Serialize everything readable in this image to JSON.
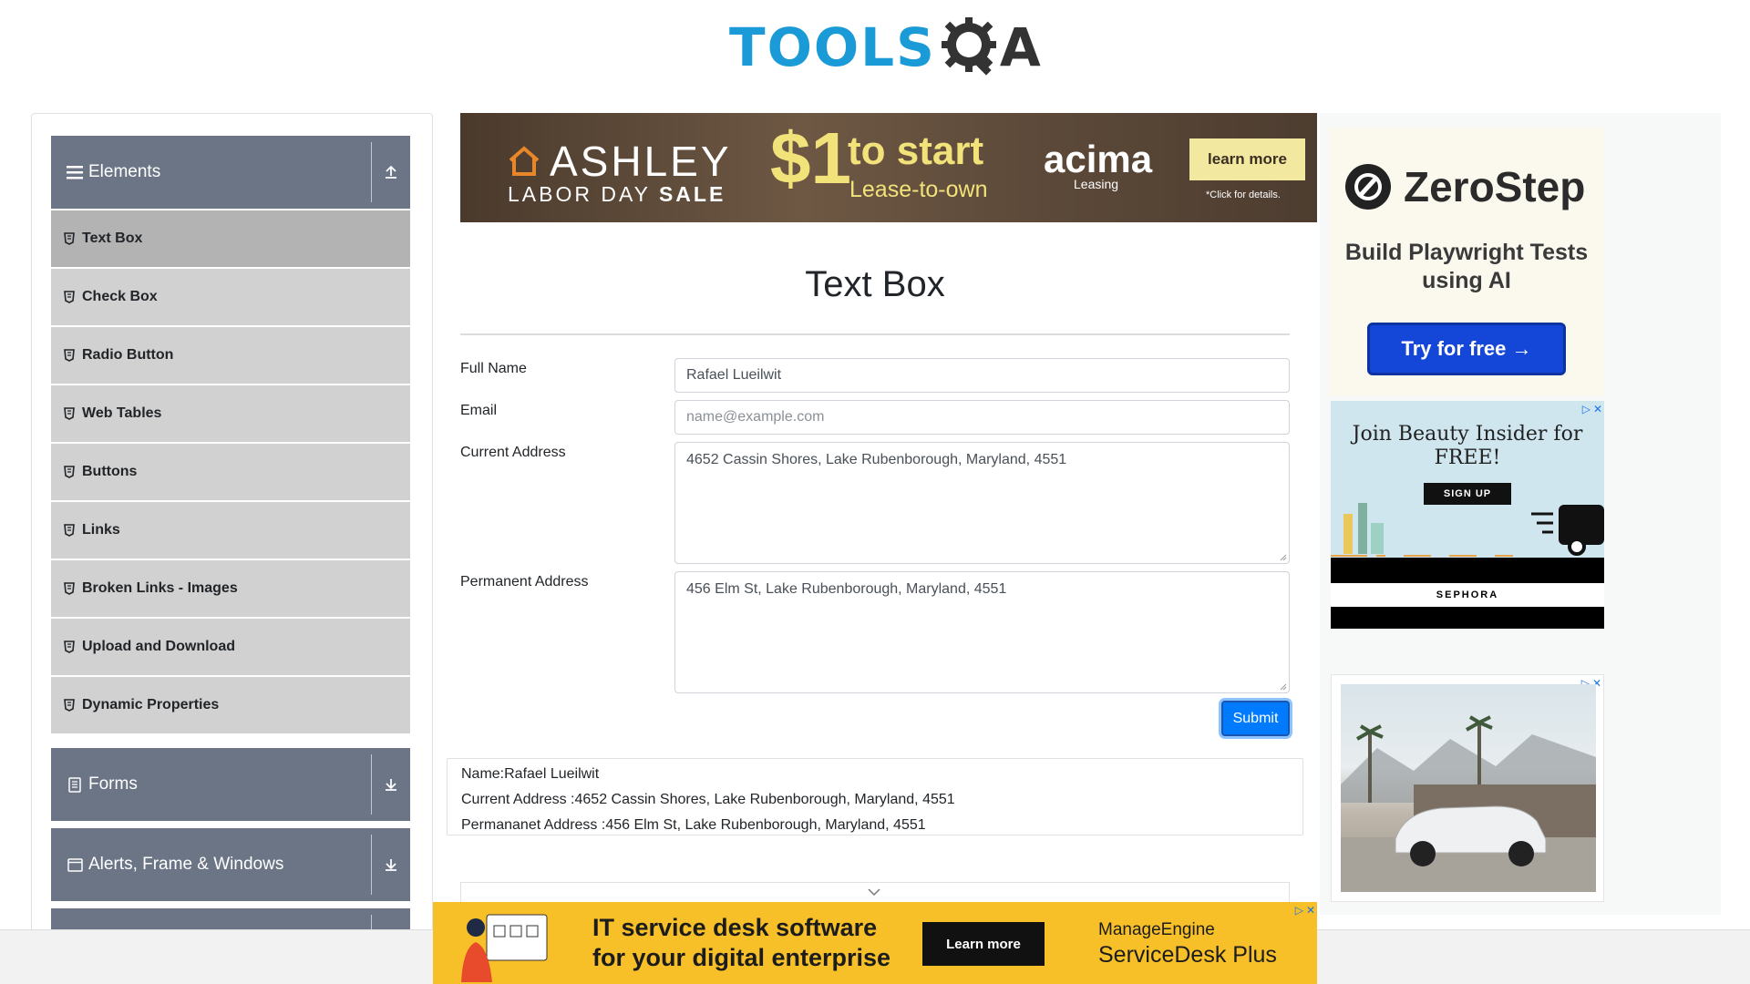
{
  "header": {
    "logo_tools": "TOOLS",
    "logo_qa": "A"
  },
  "sidebar": {
    "groups": [
      {
        "label": "Elements",
        "icon": "hamburger-icon",
        "arrow": "arrow-up-icon"
      },
      {
        "label": "Forms",
        "icon": "document-icon",
        "arrow": "arrow-down-icon"
      },
      {
        "label": "Alerts, Frame & Windows",
        "icon": "window-icon",
        "arrow": "arrow-down-icon"
      }
    ],
    "items": [
      {
        "label": "Text Box",
        "active": true
      },
      {
        "label": "Check Box"
      },
      {
        "label": "Radio Button"
      },
      {
        "label": "Web Tables"
      },
      {
        "label": "Buttons"
      },
      {
        "label": "Links"
      },
      {
        "label": "Broken Links - Images"
      },
      {
        "label": "Upload and Download"
      },
      {
        "label": "Dynamic Properties"
      }
    ]
  },
  "top_ad": {
    "brand": "ASHLEY",
    "labor": "LABOR DAY",
    "sale": "SALE",
    "dollar": "$1",
    "to_start": "to start",
    "lease": "Lease-to-own",
    "acima": "acima",
    "acima_sub": "Leasing",
    "cta": "learn more",
    "fine": "*Click for details."
  },
  "form": {
    "title": "Text Box",
    "full_name_label": "Full Name",
    "full_name_value": "Rafael Lueilwit",
    "email_label": "Email",
    "email_placeholder": "name@example.com",
    "current_address_label": "Current Address",
    "current_address_value": "4652 Cassin Shores, Lake Rubenborough, Maryland, 4551",
    "permanent_address_label": "Permanent Address",
    "permanent_address_value": "456 Elm St, Lake Rubenborough, Maryland, 4551",
    "submit": "Submit"
  },
  "output": {
    "name": "Name:Rafael Lueilwit",
    "current": "Current Address :4652 Cassin Shores, Lake Rubenborough, Maryland, 4551",
    "permanent": "Permananet Address :456 Elm St, Lake Rubenborough, Maryland, 4551"
  },
  "right_ads": {
    "zerostep": {
      "brand": "ZeroStep",
      "tagline": "Build Playwright Tests using AI",
      "cta": "Try for free →"
    },
    "sephora": {
      "title": "Join Beauty Insider for FREE!",
      "cta": "SIGN UP",
      "brand": "SEPHORA"
    }
  },
  "bottom_ad": {
    "line1": "IT service desk software",
    "line2": "for your digital enterprise",
    "cta": "Learn more",
    "brand1": "ManageEngine",
    "brand2": "ServiceDesk Plus"
  },
  "colors": {
    "sidebar_group": "#6b7585",
    "sidebar_item": "#d1d1d1",
    "sidebar_item_active": "#b3b3b3",
    "primary": "#007bff",
    "logo_blue": "#1a9ad6"
  }
}
